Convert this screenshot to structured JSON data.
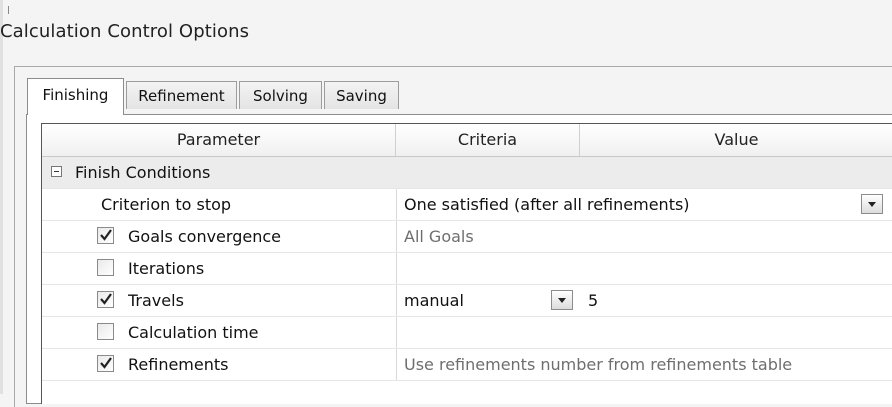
{
  "window": {
    "title": "Calculation Control Options"
  },
  "tabs": [
    {
      "label": "Finishing",
      "active": true
    },
    {
      "label": "Refinement",
      "active": false
    },
    {
      "label": "Solving",
      "active": false
    },
    {
      "label": "Saving",
      "active": false
    }
  ],
  "table": {
    "headers": {
      "parameter": "Parameter",
      "criteria": "Criteria",
      "value": "Value"
    },
    "group": {
      "label": "Finish Conditions",
      "expanded": true
    },
    "criterion": {
      "label": "Criterion to stop",
      "value": "One satisfied (after all refinements)"
    },
    "rows": [
      {
        "label": "Goals convergence",
        "checked": true,
        "criteria": "All Goals"
      },
      {
        "label": "Iterations",
        "checked": false,
        "criteria": ""
      },
      {
        "label": "Travels",
        "checked": true,
        "criteria": "manual",
        "value": "5"
      },
      {
        "label": "Calculation time",
        "checked": false,
        "criteria": ""
      },
      {
        "label": "Refinements",
        "checked": true,
        "criteria": "Use refinements number from refinements table"
      }
    ]
  }
}
